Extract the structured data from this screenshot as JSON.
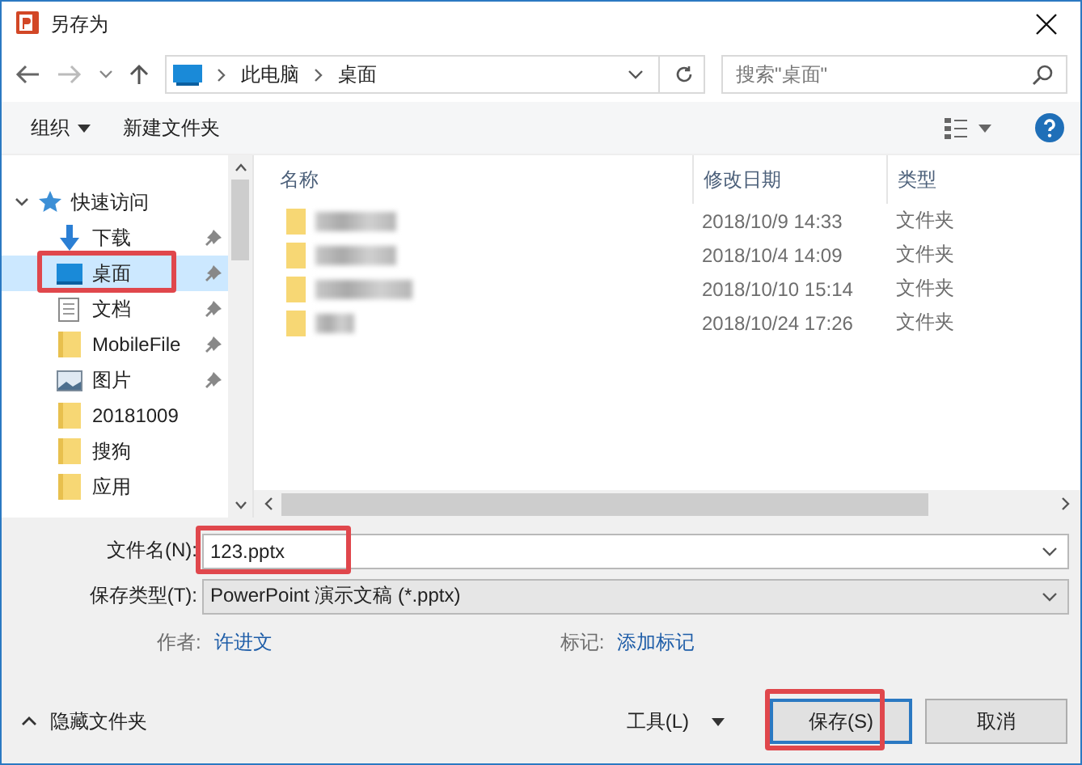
{
  "window": {
    "title": "另存为"
  },
  "nav": {
    "path": [
      "此电脑",
      "桌面"
    ],
    "search": {
      "placeholder": "搜索\"桌面\""
    }
  },
  "toolbar": {
    "organize": "组织",
    "new_folder": "新建文件夹"
  },
  "sidebar": {
    "items": [
      {
        "label": "快速访问",
        "kind": "star",
        "expanded": true,
        "children": [
          {
            "label": "下载",
            "kind": "download",
            "pinned": true,
            "selected": false,
            "highlighted": false
          },
          {
            "label": "桌面",
            "kind": "desktop",
            "pinned": true,
            "selected": true,
            "highlighted": true
          },
          {
            "label": "文档",
            "kind": "document",
            "pinned": true,
            "selected": false,
            "highlighted": false
          },
          {
            "label": "MobileFile",
            "kind": "folder",
            "pinned": true,
            "selected": false,
            "highlighted": false
          },
          {
            "label": "图片",
            "kind": "pictures",
            "pinned": true,
            "selected": false,
            "highlighted": false
          },
          {
            "label": "20181009",
            "kind": "folder",
            "pinned": false,
            "selected": false,
            "highlighted": false
          },
          {
            "label": "搜狗",
            "kind": "folder",
            "pinned": false,
            "selected": false,
            "highlighted": false
          },
          {
            "label": "应用",
            "kind": "folder",
            "pinned": false,
            "selected": false,
            "highlighted": false
          }
        ]
      }
    ]
  },
  "table": {
    "columns": [
      "名称",
      "修改日期",
      "类型"
    ],
    "rows": [
      {
        "modified": "2018/10/9 14:33",
        "type": "文件夹"
      },
      {
        "modified": "2018/10/4 14:09",
        "type": "文件夹"
      },
      {
        "modified": "2018/10/10 15:14",
        "type": "文件夹"
      },
      {
        "modified": "2018/10/24 17:26",
        "type": "文件夹"
      }
    ]
  },
  "form": {
    "filename": {
      "label": "文件名(N):",
      "value": "123.pptx",
      "highlighted": true
    },
    "filetype": {
      "label": "保存类型(T):",
      "value": "PowerPoint 演示文稿 (*.pptx)"
    },
    "author": {
      "label": "作者:",
      "value": "许进文"
    },
    "tags": {
      "label": "标记:",
      "value": "添加标记"
    }
  },
  "footer": {
    "hide_folders": "隐藏文件夹",
    "tools": "工具(L)",
    "buttons": [
      {
        "label": "保存(S)",
        "primary": true,
        "highlighted": true
      },
      {
        "label": "取消",
        "primary": false,
        "highlighted": false
      }
    ]
  }
}
